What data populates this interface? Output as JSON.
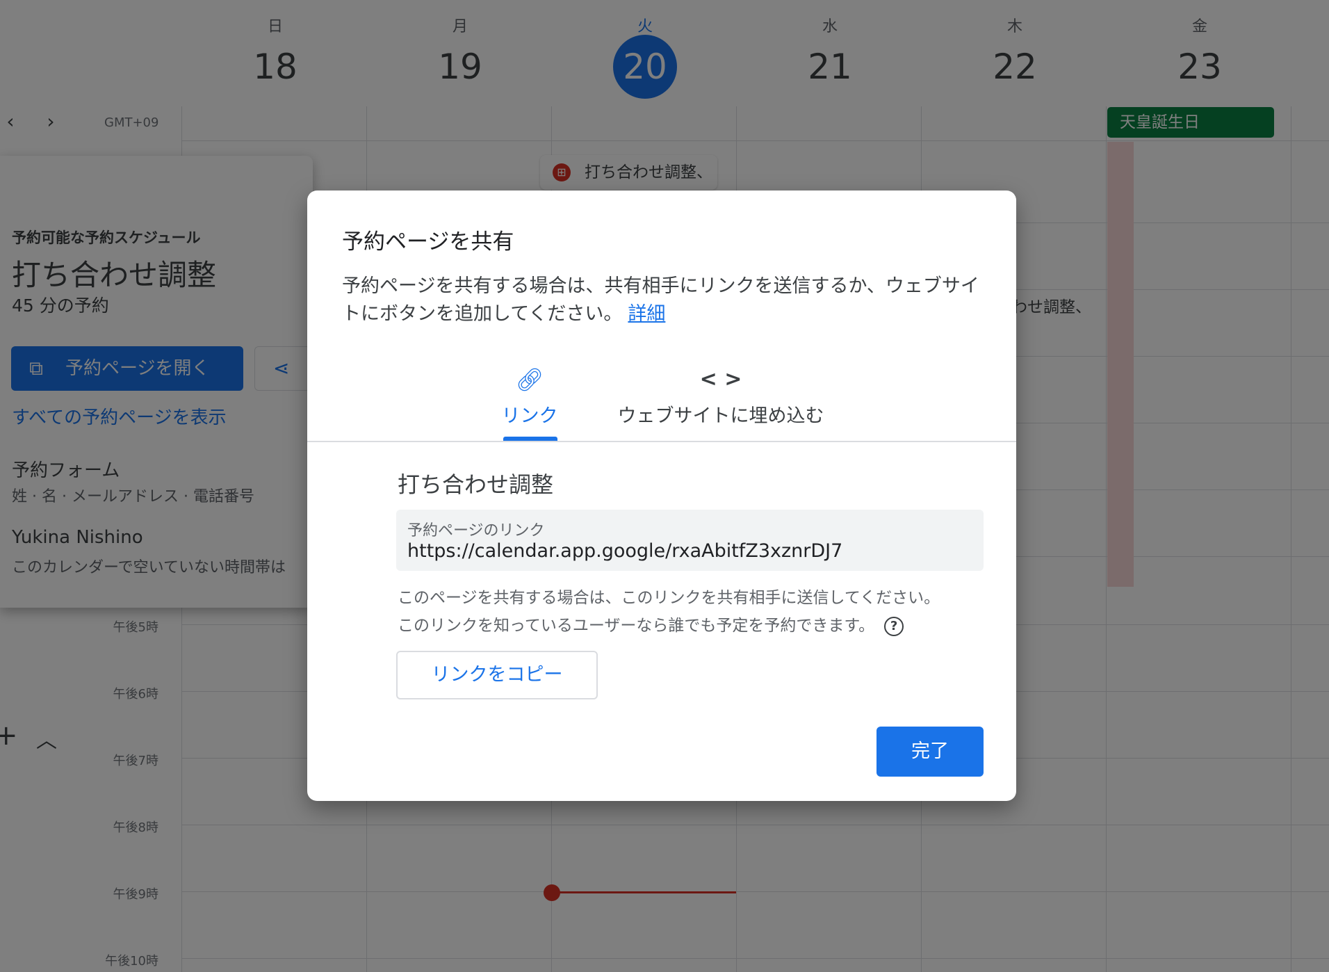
{
  "calendar": {
    "timezone": "GMT+09",
    "days": [
      {
        "name": "日",
        "date": "18"
      },
      {
        "name": "月",
        "date": "19"
      },
      {
        "name": "火",
        "date": "20"
      },
      {
        "name": "水",
        "date": "21"
      },
      {
        "name": "木",
        "date": "22"
      },
      {
        "name": "金",
        "date": "23"
      }
    ],
    "today_index": 2,
    "hour_labels": {
      "h17": "午後5時",
      "h18": "午後6時",
      "h19": "午後7時",
      "h20": "午後8時",
      "h21": "午後9時",
      "h22": "午後10時"
    },
    "holiday": "天皇誕生日",
    "bookable_chip": "打ち合わせ調整、",
    "bg_event_text": "わせ調整、"
  },
  "detail_panel": {
    "kicker": "予約可能な予約スケジュール",
    "title": "打ち合わせ調整",
    "duration": "45 分の予約",
    "open_page_button": "予約ページを開く",
    "all_pages_link": "すべての予約ページを表示",
    "form_label": "予約フォーム",
    "form_fields": "姓 · 名 · メールアドレス · 電話番号",
    "owner_name": "Yukina Nishino",
    "owner_note": "このカレンダーで空いていない時間帯は"
  },
  "dialog": {
    "title": "予約ページを共有",
    "description": "予約ページを共有する場合は、共有相手にリンクを送信するか、ウェブサイトにボタンを追加してください。",
    "details_link": "詳細",
    "tabs": {
      "link": "リンク",
      "embed": "ウェブサイトに埋め込む"
    },
    "page_title": "打ち合わせ調整",
    "link_field": {
      "label": "予約ページのリンク",
      "value": "https://calendar.app.google/rxaAbitfZ3xznrDJ7"
    },
    "help_line1": "このページを共有する場合は、このリンクを共有相手に送信してください。",
    "help_line2": "このリンクを知っているユーザーなら誰でも予定を予約できます。",
    "copy_button": "リンクをコピー",
    "done_button": "完了"
  },
  "colors": {
    "accent": "#1a73e8",
    "holiday": "#0b8043",
    "now_indicator": "#d93025"
  }
}
